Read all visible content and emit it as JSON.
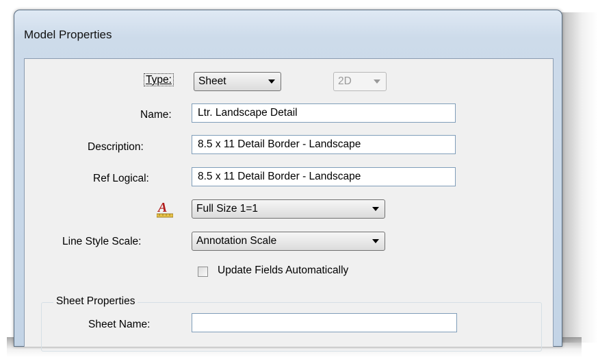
{
  "window": {
    "title": "Model Properties"
  },
  "form": {
    "type_label": "Type:",
    "type_value": "Sheet",
    "dimension_value": "2D",
    "name_label": "Name:",
    "name_value": "Ltr. Landscape Detail",
    "description_label": "Description:",
    "description_value": "8.5 x 11 Detail Border - Landscape",
    "ref_logical_label": "Ref Logical:",
    "ref_logical_value": "8.5 x 11 Detail Border - Landscape",
    "annotation_scale_icon": "annotation-scale-icon",
    "annotation_scale_value": "Full Size 1=1",
    "line_style_scale_label": "Line Style Scale:",
    "line_style_scale_value": "Annotation Scale",
    "update_fields_label": "Update Fields Automatically",
    "update_fields_checked": false
  },
  "sheet_properties": {
    "title": "Sheet Properties",
    "sheet_name_label": "Sheet Name:",
    "sheet_name_value": ""
  },
  "colors": {
    "title_bar": "#cddbea",
    "client_bg": "#f0f0f0",
    "input_border": "#7f9db9"
  }
}
